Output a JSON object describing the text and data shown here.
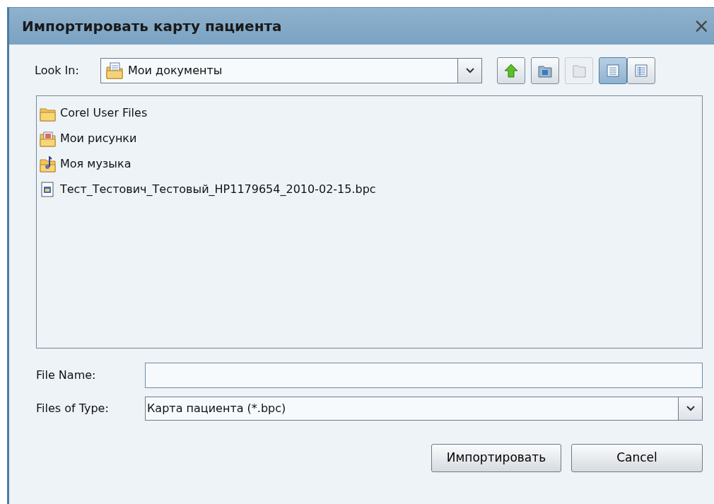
{
  "window": {
    "title": "Импортировать карту пациента",
    "close": "×"
  },
  "look_in": {
    "label": "Look In:",
    "value": "Мои документы"
  },
  "toolbar": [
    {
      "kind": "up",
      "disabled": false,
      "selected": false
    },
    {
      "kind": "home",
      "disabled": false,
      "selected": false
    },
    {
      "kind": "new-folder",
      "disabled": true,
      "selected": false
    },
    {
      "kind": "list",
      "disabled": false,
      "selected": true
    },
    {
      "kind": "details",
      "disabled": false,
      "selected": false
    }
  ],
  "files": [
    {
      "kind": "folder",
      "name": "Corel User Files"
    },
    {
      "kind": "pictures",
      "name": "Мои рисунки"
    },
    {
      "kind": "music",
      "name": "Моя музыка"
    },
    {
      "kind": "file",
      "name": "Тест_Тестович_Тестовый_HP1179654_2010-02-15.bpc"
    }
  ],
  "file_name": {
    "label": "File Name:"
  },
  "file_type": {
    "label": "Files of Type:",
    "value": "Карта пациента (*.bpc)"
  },
  "buttons": [
    "Импортировать",
    "Cancel"
  ]
}
